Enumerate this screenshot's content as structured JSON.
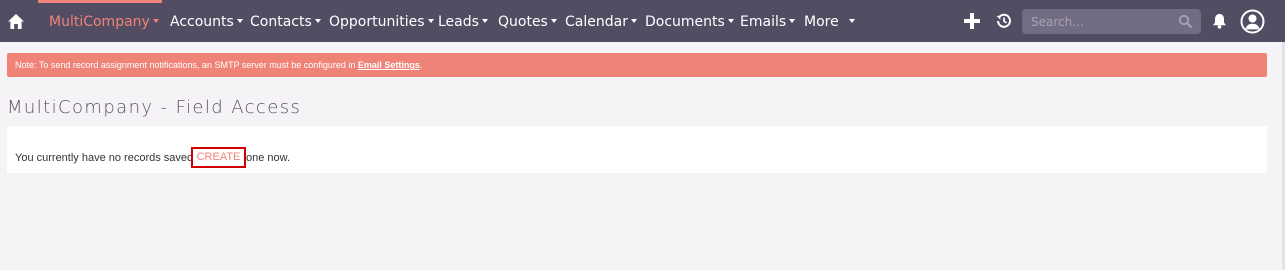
{
  "nav": {
    "items": [
      {
        "label": "MultiCompany",
        "active": true
      },
      {
        "label": "Accounts"
      },
      {
        "label": "Contacts"
      },
      {
        "label": "Opportunities"
      },
      {
        "label": "Leads"
      },
      {
        "label": "Quotes"
      },
      {
        "label": "Calendar"
      },
      {
        "label": "Documents"
      },
      {
        "label": "Emails"
      },
      {
        "label": "More"
      }
    ],
    "icons": [
      "home-icon",
      "plus-icon",
      "history-icon",
      "search-icon",
      "bell-icon",
      "user-icon"
    ],
    "search_placeholder": "Search..."
  },
  "alert": {
    "text": "Note: To send record assignment notifications, an SMTP server must be configured in ",
    "link": "Email Settings",
    "suffix": "."
  },
  "page": {
    "title": "MultiCompany - Field Access",
    "empty_prefix": "You currently have no records saved.",
    "create_label": "CREATE",
    "empty_suffix": "one now."
  },
  "colors": {
    "navbar": "#534d64",
    "accent": "#f08377",
    "highlight_border": "#d10000",
    "background": "#f5f3f5"
  }
}
